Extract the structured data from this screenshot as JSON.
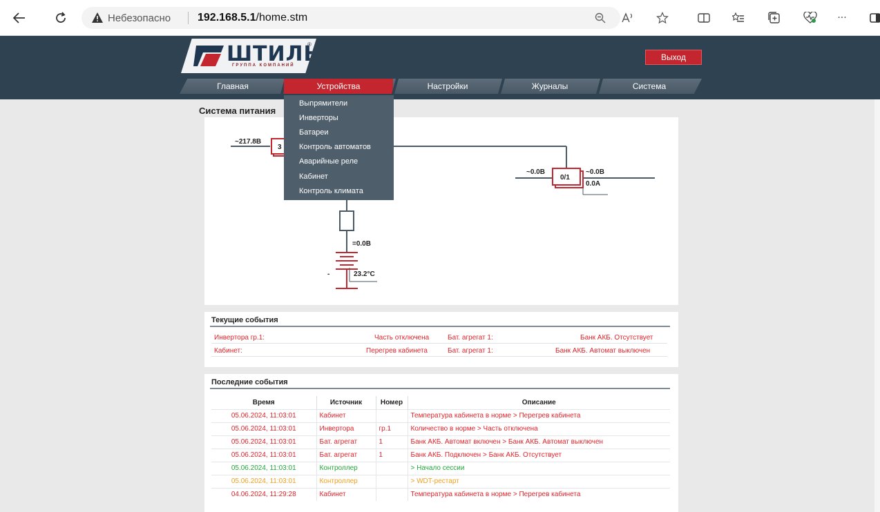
{
  "browser": {
    "insecure_label": "Небезопасно",
    "url_host": "192.168.5.1",
    "url_path": "/home.stm",
    "more": "···"
  },
  "header": {
    "logo_text": "ШТИЛЬ",
    "logo_subtitle": "ГРУППА КОМПАНИЙ",
    "logo_reg": "®",
    "exit_label": "Выход"
  },
  "nav": {
    "items": [
      "Главная",
      "Устройства",
      "Настройки",
      "Журналы",
      "Система"
    ],
    "active": "Устройства"
  },
  "dropdown": {
    "items": [
      "Выпрямители",
      "Инверторы",
      "Батареи",
      "Контроль автоматов",
      "Аварийные реле",
      "Кабинет",
      "Контроль климата"
    ]
  },
  "diagram": {
    "title": "Система питания",
    "input_voltage": "~217.8В",
    "rectifier_count": "3",
    "inverter_in_voltage": "~0.0В",
    "inverter_count": "0/1",
    "inverter_out_voltage": "~0.0В",
    "inverter_current": "0.0А",
    "dc_voltage": "=0.0В",
    "battery_temp": "23.2°C",
    "battery_minus": "-"
  },
  "current_events": {
    "title": "Текущие события",
    "rows": [
      {
        "src1": "Инвертора гр.1:",
        "val1": "Часть отключена",
        "src2": "Бат. агрегат 1:",
        "val2": "Банк АКБ. Отсутствует"
      },
      {
        "src1": "Кабинет:",
        "val1": "Перегрев кабинета",
        "src2": "Бат. агрегат 1:",
        "val2": "Банк АКБ. Автомат выключен"
      }
    ],
    "color": "#e0242b"
  },
  "last_events": {
    "title": "Последние события",
    "headers": {
      "time": "Время",
      "source": "Источник",
      "num": "Номер",
      "desc": "Описание"
    },
    "rows": [
      {
        "time": "05.06.2024, 11:03:01",
        "source": "Кабинет",
        "num": "",
        "desc": "Температура кабинета в норме > Перегрев кабинета",
        "color": "#e0242b"
      },
      {
        "time": "05.06.2024, 11:03:01",
        "source": "Инвертора",
        "num": "гр.1",
        "desc": "Количество в норме > Часть отключена",
        "color": "#e0242b"
      },
      {
        "time": "05.06.2024, 11:03:01",
        "source": "Бат. агрегат",
        "num": "1",
        "desc": "Банк АКБ. Автомат включен > Банк АКБ. Автомат выключен",
        "color": "#e0242b"
      },
      {
        "time": "05.06.2024, 11:03:01",
        "source": "Бат. агрегат",
        "num": "1",
        "desc": "Банк АКБ. Подключен > Банк АКБ. Отсутствует",
        "color": "#e0242b"
      },
      {
        "time": "05.06.2024, 11:03:01",
        "source": "Контроллер",
        "num": "",
        "desc": "> Начало сессии",
        "color": "#20a83a"
      },
      {
        "time": "05.06.2024, 11:03:01",
        "source": "Контроллер",
        "num": "",
        "desc": "> WDT-рестарт",
        "color": "#f0a020"
      },
      {
        "time": "04.06.2024, 11:29:28",
        "source": "Кабинет",
        "num": "",
        "desc": "Температура кабинета в норме > Перегрев кабинета",
        "color": "#e0242b"
      }
    ]
  },
  "colors": {
    "accent_red": "#c3262e",
    "header_bg": "#2f4251",
    "alarm_red": "#e0242b"
  }
}
